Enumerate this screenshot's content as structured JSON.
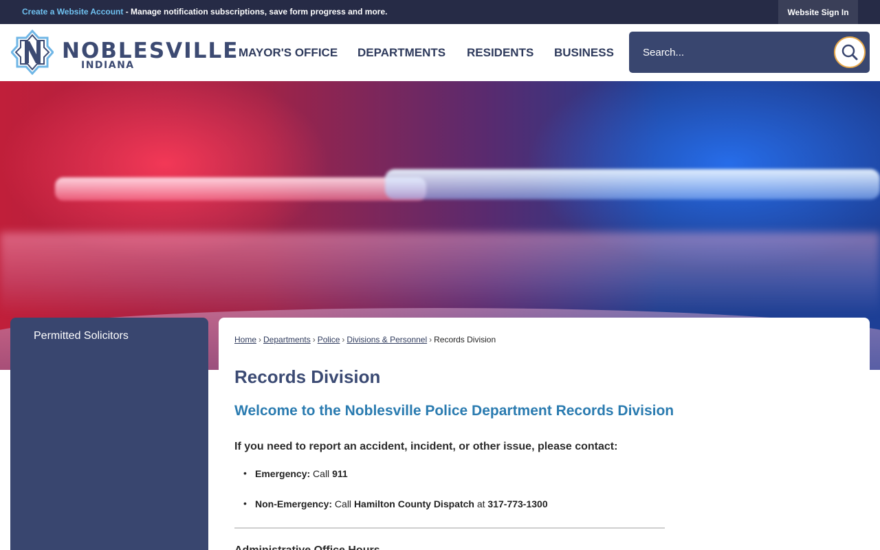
{
  "topbar": {
    "create_account_link": "Create a Website Account",
    "message": " - Manage notification subscriptions, save form progress and more.",
    "sign_in": "Website Sign In"
  },
  "header": {
    "logo_title": "NOBLESVILLE",
    "logo_subtitle": "INDIANA",
    "nav": [
      "MAYOR'S OFFICE",
      "DEPARTMENTS",
      "RESIDENTS",
      "BUSINESS"
    ],
    "search_placeholder": "Search...",
    "search_icon": "search-icon"
  },
  "sidebar": {
    "items": [
      {
        "label": "Permitted Solicitors"
      }
    ]
  },
  "breadcrumb": {
    "links": [
      "Home",
      "Departments",
      "Police",
      "Divisions & Personnel"
    ],
    "current": "Records Division",
    "separator": "›"
  },
  "main": {
    "title": "Records Division",
    "welcome": "Welcome to the Noblesville Police Department Records Division",
    "intro": "If you need to report an accident, incident, or other issue, please contact:",
    "contacts": [
      {
        "label": "Emergency:",
        "pre": " Call ",
        "value": "911",
        "mid": "",
        "extra": ""
      },
      {
        "label": "Non-Emergency:",
        "pre": " Call ",
        "value": "Hamilton County Dispatch",
        "mid": " at ",
        "extra": "317-773-1300"
      }
    ],
    "next_heading": "Administrative Office Hours"
  },
  "colors": {
    "topbar": "#262b46",
    "brand_navy": "#39466f",
    "link_blue": "#2a7bb0",
    "accent_orange": "#e8a94b"
  }
}
